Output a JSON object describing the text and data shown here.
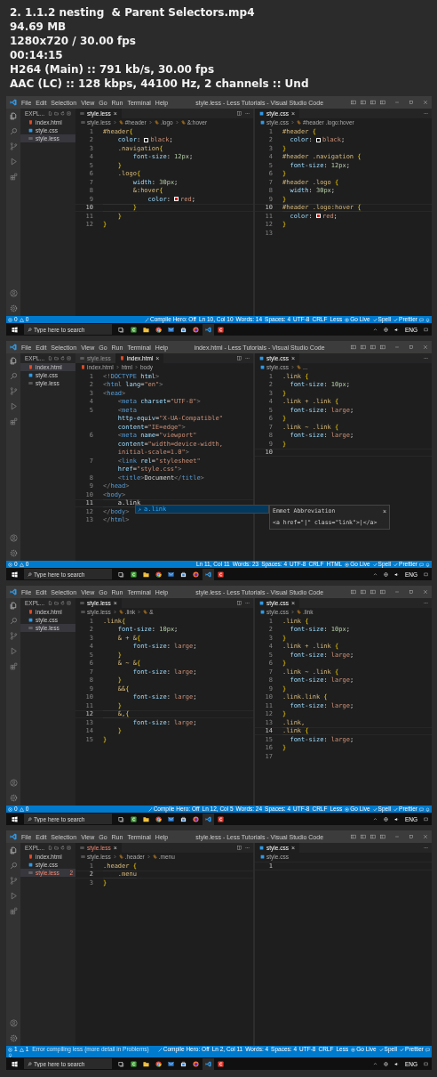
{
  "file_info": {
    "name": "2. 1.1.2 nesting  & Parent Selectors.mp4",
    "size": "94.69 MB",
    "resolution": "1280x720 / 30.00 fps",
    "duration": "00:14:15",
    "video": "H264 (Main) :: 791 kb/s, 30.00 fps",
    "audio": "AAC (LC) :: 128 kbps, 44100 Hz, 2 channels :: Und"
  },
  "frames": [
    {
      "title": "style.less - Less Tutorials - Visual Studio Code",
      "menu": [
        "File",
        "Edit",
        "Selection",
        "View",
        "Go",
        "Run",
        "Terminal",
        "Help"
      ],
      "explorer": {
        "label": "EXPL...",
        "files": [
          {
            "name": "index.html",
            "kind": "html",
            "selected": false,
            "error": false
          },
          {
            "name": "style.css",
            "kind": "css",
            "selected": false,
            "error": false
          },
          {
            "name": "style.less",
            "kind": "less",
            "selected": true,
            "error": false
          }
        ]
      },
      "left": {
        "kind": "less",
        "tabs": [
          {
            "label": "style.less",
            "kind": "less",
            "selected": true,
            "error": false,
            "close": "×"
          }
        ],
        "breadcrumbs": [
          "style.less",
          "#header",
          ".logo",
          "&:hover"
        ],
        "lines": [
          {
            "num": "1",
            "text": "#header{",
            "current": false
          },
          {
            "num": "2",
            "text": "    color: black;",
            "color": "#000000",
            "current": false
          },
          {
            "num": "3",
            "text": "    .navigation{",
            "current": false
          },
          {
            "num": "4",
            "text": "        font-size: 12px;",
            "current": false
          },
          {
            "num": "5",
            "text": "    }",
            "current": false
          },
          {
            "num": "6",
            "text": "    .logo{",
            "current": false
          },
          {
            "num": "7",
            "text": "        width: 30px;",
            "current": false
          },
          {
            "num": "8",
            "text": "        &:hover{",
            "current": false
          },
          {
            "num": "9",
            "text": "            color: red;",
            "color": "#e51400",
            "current": false
          },
          {
            "num": "10",
            "text": "        }",
            "current": true
          },
          {
            "num": "11",
            "text": "    }",
            "current": false
          },
          {
            "num": "12",
            "text": "}",
            "current": false
          }
        ]
      },
      "right": {
        "kind": "css",
        "tabs": [
          {
            "label": "style.css",
            "kind": "css",
            "selected": true,
            "error": false,
            "close": "×"
          }
        ],
        "breadcrumbs": [
          "style.css",
          "#header .logo:hover"
        ],
        "lines": [
          {
            "num": "1",
            "text": "#header {",
            "current": false
          },
          {
            "num": "2",
            "text": "  color: black;",
            "color": "#000000",
            "current": false
          },
          {
            "num": "3",
            "text": "}",
            "current": false
          },
          {
            "num": "4",
            "text": "#header .navigation {",
            "current": false
          },
          {
            "num": "5",
            "text": "  font-size: 12px;",
            "current": false
          },
          {
            "num": "6",
            "text": "}",
            "current": false
          },
          {
            "num": "7",
            "text": "#header .logo {",
            "current": false
          },
          {
            "num": "8",
            "text": "  width: 30px;",
            "current": false
          },
          {
            "num": "9",
            "text": "}",
            "current": false
          },
          {
            "num": "10",
            "text": "#header .logo:hover {",
            "current": true
          },
          {
            "num": "11",
            "text": "  color: red;",
            "color": "#e51400",
            "current": false
          },
          {
            "num": "12",
            "text": "}",
            "current": false
          },
          {
            "num": "13",
            "current": false
          }
        ]
      },
      "status": {
        "errors": "0",
        "warnings": "0",
        "items": [
          {
            "text": "Compile Hero: Off",
            "kind": "compiler"
          },
          {
            "text": "Ln 10, Col 10",
            "kind": "text"
          },
          {
            "text": "Words: 14",
            "kind": "text"
          },
          {
            "text": "Spaces: 4",
            "kind": "text"
          },
          {
            "text": "UTF-8",
            "kind": "text"
          },
          {
            "text": "CRLF",
            "kind": "text"
          },
          {
            "text": "Less",
            "kind": "text"
          },
          {
            "text": "Go Live",
            "kind": "server"
          },
          {
            "text": "Spell",
            "kind": "checker"
          },
          {
            "text": "Prettier",
            "kind": "checker"
          }
        ]
      },
      "taskbar": {
        "search_placeholder": "Type here to search",
        "language": "ENG"
      }
    },
    {
      "title": "index.html - Less Tutorials - Visual Studio Code",
      "menu": [
        "File",
        "Edit",
        "Selection",
        "View",
        "Go",
        "Run",
        "Terminal",
        "Help"
      ],
      "explorer": {
        "label": "EXPL...",
        "files": [
          {
            "name": "index.html",
            "kind": "html",
            "selected": true,
            "error": false
          },
          {
            "name": "style.css",
            "kind": "css",
            "selected": false,
            "error": false
          },
          {
            "name": "style.less",
            "kind": "less",
            "selected": false,
            "error": false
          }
        ]
      },
      "left": {
        "kind": "html",
        "tabs": [
          {
            "label": "style.less",
            "kind": "less",
            "selected": false,
            "error": false
          },
          {
            "label": "index.html",
            "kind": "html",
            "selected": true,
            "error": false,
            "close": "×"
          }
        ],
        "breadcrumbs": [
          "index.html",
          "html",
          "body"
        ],
        "lines": [
          {
            "num": "1",
            "text": "<!DOCTYPE html>",
            "current": false
          },
          {
            "num": "2",
            "text": "<html lang=\"en\">",
            "current": false
          },
          {
            "num": "3",
            "text": "<head>",
            "current": false
          },
          {
            "num": "4",
            "text": "    <meta charset=\"UTF-8\">",
            "current": false
          },
          {
            "num": "5",
            "text": "    <meta",
            "current": false
          },
          {
            "text": "    http-equiv=\"X-UA-Compatible\"",
            "current": false
          },
          {
            "text": "    content=\"IE=edge\">",
            "current": false
          },
          {
            "num": "6",
            "text": "    <meta name=\"viewport\"",
            "current": false
          },
          {
            "text": "    content=\"width=device-width,",
            "current": false
          },
          {
            "text": "    initial-scale=1.0\">",
            "current": false
          },
          {
            "num": "7",
            "text": "    <link rel=\"stylesheet\"",
            "current": false
          },
          {
            "text": "    href=\"style.css\">",
            "current": false
          },
          {
            "num": "8",
            "text": "    <title>Document</title>",
            "current": false
          },
          {
            "num": "9",
            "text": "</head>",
            "current": false
          },
          {
            "num": "10",
            "text": "<body>",
            "current": false
          },
          {
            "num": "11",
            "text": "    a.link",
            "current": true
          },
          {
            "num": "12",
            "text": "</body>",
            "current": false
          },
          {
            "num": "13",
            "text": "</html>",
            "current": false
          }
        ]
      },
      "right": {
        "kind": "css",
        "tabs": [
          {
            "label": "style.css",
            "kind": "css",
            "selected": true,
            "error": false,
            "close": "×"
          }
        ],
        "breadcrumbs": [
          "style.css",
          "..."
        ],
        "lines": [
          {
            "num": "1",
            "text": ".link {",
            "current": false
          },
          {
            "num": "2",
            "text": "  font-size: 10px;",
            "current": false
          },
          {
            "num": "3",
            "text": "}",
            "current": false
          },
          {
            "num": "4",
            "text": ".link + .link {",
            "current": false
          },
          {
            "num": "5",
            "text": "  font-size: large;",
            "current": false
          },
          {
            "num": "6",
            "text": "}",
            "current": false
          },
          {
            "num": "7",
            "text": ".link ~ .link {",
            "current": false
          },
          {
            "num": "8",
            "text": "  font-size: large;",
            "current": false
          },
          {
            "num": "9",
            "text": "}",
            "current": false
          },
          {
            "num": "10",
            "current": true
          }
        ]
      },
      "suggest": {
        "items": [
          {
            "label": "a.link",
            "selected": true
          }
        ],
        "detail_title": "Emmet Abbreviation",
        "detail_close": "×",
        "detail_code": "<a href=\"|\" class=\"link\">|</a>"
      },
      "status": {
        "errors": "0",
        "warnings": "0",
        "items": [
          {
            "text": "Ln 11, Col 11",
            "kind": "text"
          },
          {
            "text": "Words: 23",
            "kind": "text"
          },
          {
            "text": "Spaces: 4",
            "kind": "text"
          },
          {
            "text": "UTF-8",
            "kind": "text"
          },
          {
            "text": "CRLF",
            "kind": "text"
          },
          {
            "text": "HTML",
            "kind": "text"
          },
          {
            "text": "Go Live",
            "kind": "server"
          },
          {
            "text": "Spell",
            "kind": "checker"
          },
          {
            "text": "Prettier",
            "kind": "checker"
          }
        ]
      },
      "taskbar": {
        "search_placeholder": "Type here to search",
        "language": "ENG"
      }
    },
    {
      "title": "style.less - Less Tutorials - Visual Studio Code",
      "menu": [
        "File",
        "Edit",
        "Selection",
        "View",
        "Go",
        "Run",
        "Terminal",
        "Help"
      ],
      "explorer": {
        "label": "EXPL...",
        "files": [
          {
            "name": "index.html",
            "kind": "html",
            "selected": false,
            "error": false
          },
          {
            "name": "style.css",
            "kind": "css",
            "selected": false,
            "error": false
          },
          {
            "name": "style.less",
            "kind": "less",
            "selected": true,
            "error": false
          }
        ]
      },
      "left": {
        "kind": "less",
        "tabs": [
          {
            "label": "style.less",
            "kind": "less",
            "selected": true,
            "error": false,
            "close": "×"
          }
        ],
        "breadcrumbs": [
          "style.less",
          ".link",
          "&"
        ],
        "lines": [
          {
            "num": "1",
            "text": ".link{",
            "current": false
          },
          {
            "num": "2",
            "text": "    font-size: 10px;",
            "current": false
          },
          {
            "num": "3",
            "text": "    & + &{",
            "current": false
          },
          {
            "num": "4",
            "text": "        font-size: large;",
            "current": false
          },
          {
            "num": "5",
            "text": "    }",
            "current": false
          },
          {
            "num": "6",
            "text": "    & ~ &{",
            "current": false
          },
          {
            "num": "7",
            "text": "        font-size: large;",
            "current": false
          },
          {
            "num": "8",
            "text": "    }",
            "current": false
          },
          {
            "num": "9",
            "text": "    &&{",
            "current": false
          },
          {
            "num": "10",
            "text": "        font-size: large;",
            "current": false
          },
          {
            "num": "11",
            "text": "    }",
            "current": false
          },
          {
            "num": "12",
            "text": "    &,{",
            "current": true
          },
          {
            "num": "13",
            "text": "        font-size: large;",
            "current": false
          },
          {
            "num": "14",
            "text": "    }",
            "current": false
          },
          {
            "num": "15",
            "text": "}",
            "current": false
          }
        ]
      },
      "right": {
        "kind": "css",
        "tabs": [
          {
            "label": "style.css",
            "kind": "css",
            "selected": true,
            "error": false,
            "close": "×"
          }
        ],
        "breadcrumbs": [
          "style.css",
          ".link"
        ],
        "lines": [
          {
            "num": "1",
            "text": ".link {",
            "current": false
          },
          {
            "num": "2",
            "text": "  font-size: 10px;",
            "current": false
          },
          {
            "num": "3",
            "text": "}",
            "current": false
          },
          {
            "num": "4",
            "text": ".link + .link {",
            "current": false
          },
          {
            "num": "5",
            "text": "  font-size: large;",
            "current": false
          },
          {
            "num": "6",
            "text": "}",
            "current": false
          },
          {
            "num": "7",
            "text": ".link ~ .link {",
            "current": false
          },
          {
            "num": "8",
            "text": "  font-size: large;",
            "current": false
          },
          {
            "num": "9",
            "text": "}",
            "current": false
          },
          {
            "num": "10",
            "text": ".link.link {",
            "current": false
          },
          {
            "num": "11",
            "text": "  font-size: large;",
            "current": false
          },
          {
            "num": "12",
            "text": "}",
            "current": false
          },
          {
            "num": "13",
            "text": ".link,",
            "current": false
          },
          {
            "num": "14",
            "text": ".link {",
            "current": true
          },
          {
            "num": "15",
            "text": "  font-size: large;",
            "current": false
          },
          {
            "num": "16",
            "text": "}",
            "current": false
          },
          {
            "num": "17",
            "current": false
          }
        ]
      },
      "status": {
        "errors": "0",
        "warnings": "0",
        "items": [
          {
            "text": "Compile Hero: Off",
            "kind": "compiler"
          },
          {
            "text": "Ln 12, Col 5",
            "kind": "text"
          },
          {
            "text": "Words: 24",
            "kind": "text"
          },
          {
            "text": "Spaces: 4",
            "kind": "text"
          },
          {
            "text": "UTF-8",
            "kind": "text"
          },
          {
            "text": "CRLF",
            "kind": "text"
          },
          {
            "text": "Less",
            "kind": "text"
          },
          {
            "text": "Go Live",
            "kind": "server"
          },
          {
            "text": "Spell",
            "kind": "checker"
          },
          {
            "text": "Prettier",
            "kind": "checker"
          }
        ]
      },
      "taskbar": {
        "search_placeholder": "Type here to search",
        "language": "ENG"
      }
    },
    {
      "title": "style.less - Less Tutorials - Visual Studio Code",
      "menu": [
        "File",
        "Edit",
        "Selection",
        "View",
        "Go",
        "Run",
        "Terminal",
        "Help"
      ],
      "explorer": {
        "label": "EXPL...",
        "files": [
          {
            "name": "index.html",
            "kind": "html",
            "selected": false,
            "error": false
          },
          {
            "name": "style.css",
            "kind": "css",
            "selected": false,
            "error": false
          },
          {
            "name": "style.less",
            "kind": "less",
            "selected": true,
            "error": true,
            "badge": "2"
          }
        ]
      },
      "left": {
        "kind": "less",
        "tabs": [
          {
            "label": "style.less",
            "kind": "less",
            "selected": true,
            "error": true,
            "close": "×"
          }
        ],
        "breadcrumbs": [
          "style.less",
          ".header",
          ".menu"
        ],
        "lines": [
          {
            "num": "1",
            "text": ".header {",
            "current": false
          },
          {
            "num": "2",
            "text": "    .menu",
            "current": true
          },
          {
            "num": "3",
            "text": "}",
            "current": false
          }
        ]
      },
      "right": {
        "kind": "css",
        "tabs": [
          {
            "label": "style.css",
            "kind": "css",
            "selected": true,
            "error": false,
            "close": "×"
          }
        ],
        "breadcrumbs": [
          "style.css"
        ],
        "lines": [
          {
            "num": "1",
            "current": true
          }
        ]
      },
      "status": {
        "errors": "1",
        "warnings": "1",
        "message": "Error compiling less (more detail in Problems)",
        "items": [
          {
            "text": "Compile Hero: Off",
            "kind": "compiler"
          },
          {
            "text": "Ln 2, Col 11",
            "kind": "text"
          },
          {
            "text": "Words: 4",
            "kind": "text"
          },
          {
            "text": "Spaces: 4",
            "kind": "text"
          },
          {
            "text": "UTF-8",
            "kind": "text"
          },
          {
            "text": "CRLF",
            "kind": "text"
          },
          {
            "text": "Less",
            "kind": "text"
          },
          {
            "text": "Go Live",
            "kind": "server"
          },
          {
            "text": "Spell",
            "kind": "checker"
          },
          {
            "text": "Prettier",
            "kind": "checker"
          }
        ]
      },
      "taskbar": {
        "search_placeholder": "Type here to search",
        "language": "ENG"
      }
    }
  ]
}
